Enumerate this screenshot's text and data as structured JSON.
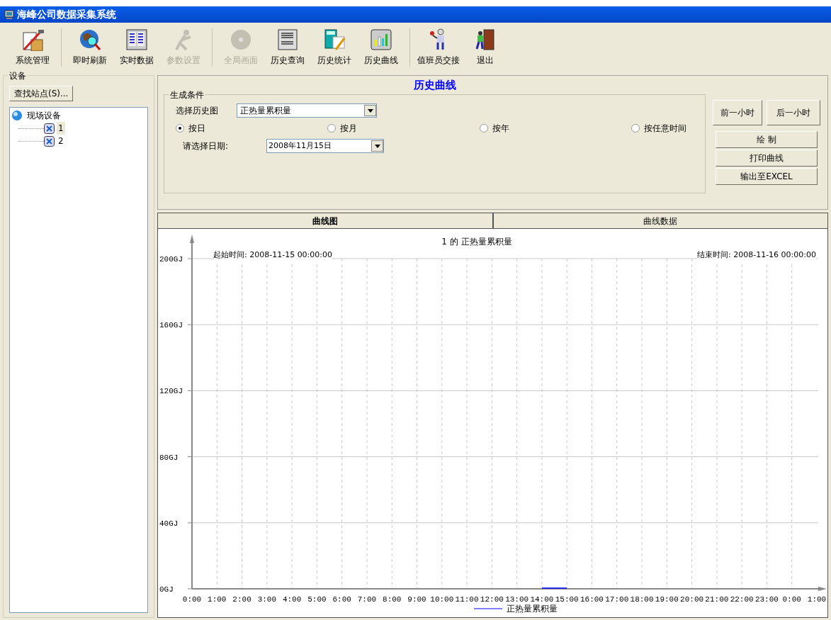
{
  "window": {
    "title": "海峰公司数据采集系统"
  },
  "toolbar": {
    "groups": [
      [
        {
          "label": "系统管理",
          "kind": "tools",
          "disabled": false
        }
      ],
      [
        {
          "label": "即时刷新",
          "kind": "globe",
          "disabled": false
        },
        {
          "label": "实时数据",
          "kind": "panel",
          "disabled": false
        },
        {
          "label": "参数设置",
          "kind": "figure",
          "disabled": true
        }
      ],
      [
        {
          "label": "全局画面",
          "kind": "disc",
          "disabled": true
        },
        {
          "label": "历史查询",
          "kind": "doc",
          "disabled": false
        },
        {
          "label": "历史统计",
          "kind": "calc",
          "disabled": false
        },
        {
          "label": "历史曲线",
          "kind": "bars",
          "disabled": false
        }
      ],
      [
        {
          "label": "值班员交接",
          "kind": "person",
          "disabled": false
        },
        {
          "label": "退出",
          "kind": "door",
          "disabled": false
        }
      ]
    ]
  },
  "sidebar": {
    "title": "设备",
    "find_button": "查找站点(S)...",
    "tree": [
      {
        "label": "现场设备",
        "expanded": true,
        "selected": false,
        "children": [
          {
            "label": "1",
            "selected": true
          },
          {
            "label": "2",
            "selected": false
          }
        ]
      }
    ]
  },
  "panel_title": "历史曲线",
  "conditions": {
    "title": "生成条件",
    "chart_label": "选择历史图",
    "chart_value": "正热量累积量",
    "modes": [
      {
        "label": "按日",
        "selected": true
      },
      {
        "label": "按月",
        "selected": false
      },
      {
        "label": "按年",
        "selected": false
      },
      {
        "label": "按任意时间",
        "selected": false
      }
    ],
    "date_label": "请选择日期:",
    "date_value": "2008年11月15日"
  },
  "buttons": {
    "prev_hour": "前一小时",
    "next_hour": "后一小时",
    "actions": [
      "绘 制",
      "打印曲线",
      "输出至EXCEL"
    ]
  },
  "tabs": [
    {
      "label": "曲线图",
      "selected": true
    },
    {
      "label": "曲线数据",
      "selected": false
    }
  ],
  "chart": {
    "start_time": "起始时间: 2008-11-15 00:00:00",
    "end_time": "结束时间: 2008-11-16 00:00:00",
    "chart_data": {
      "type": "line",
      "title": "1 的 正热量累积量",
      "categories": [
        "0:00",
        "1:00",
        "2:00",
        "3:00",
        "4:00",
        "5:00",
        "6:00",
        "7:00",
        "8:00",
        "9:00",
        "10:00",
        "11:00",
        "12:00",
        "13:00",
        "14:00",
        "15:00",
        "16:00",
        "17:00",
        "18:00",
        "19:00",
        "20:00",
        "21:00",
        "22:00",
        "23:00",
        "0:00",
        "1:00"
      ],
      "series": [
        {
          "name": "正热量累积量",
          "color": "#0000ff",
          "values": [
            null,
            null,
            null,
            null,
            null,
            null,
            null,
            null,
            null,
            null,
            null,
            null,
            null,
            null,
            0,
            0,
            null,
            null,
            null,
            null,
            null,
            null,
            null,
            null,
            null,
            null
          ]
        }
      ],
      "ylim": [
        0,
        200
      ],
      "grid": true,
      "yticks": [
        {
          "value": 0,
          "label": "0GJ"
        },
        {
          "value": 40,
          "label": "40GJ"
        },
        {
          "value": 80,
          "label": "80GJ"
        },
        {
          "value": 120,
          "label": "120GJ"
        },
        {
          "value": 160,
          "label": "160GJ"
        },
        {
          "value": 200,
          "label": "200GJ"
        }
      ]
    }
  }
}
